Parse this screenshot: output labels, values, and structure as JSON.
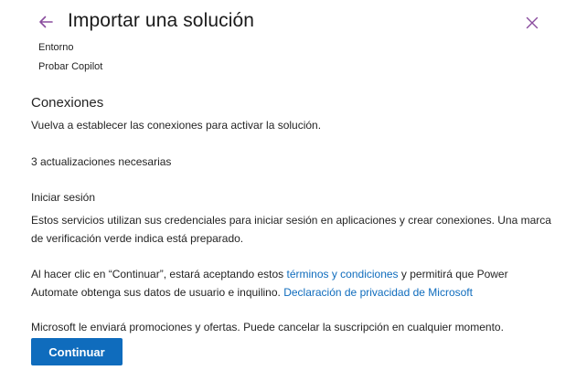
{
  "header": {
    "title": "Importar una solución",
    "back_icon": "arrow-left-icon",
    "close_icon": "close-icon",
    "accent_color": "#8a4d9e"
  },
  "environment": {
    "label": "Entorno",
    "value": "Probar Copilot"
  },
  "connections": {
    "title": "Conexiones",
    "description": "Vuelva a establecer las conexiones para activar la solución.",
    "updates_required": "3 actualizaciones necesarias"
  },
  "signin": {
    "title": "Iniciar sesión",
    "description": "Estos servicios utilizan sus credenciales para iniciar sesión en aplicaciones y crear conexiones. Una marca de verificación verde indica está preparado."
  },
  "terms": {
    "prefix": "Al hacer clic en “Continuar”, estará aceptando estos ",
    "terms_link": "términos y condiciones",
    "middle": " y permitirá que Power Automate obtenga sus datos de usuario e inquilino.  ",
    "privacy_link": "Declaración de privacidad de Microsoft"
  },
  "promo": {
    "text": "Microsoft le enviará promociones y ofertas. Puede cancelar la suscripción en cualquier momento."
  },
  "actions": {
    "continue_label": "Continuar",
    "primary_color": "#0f6cbd"
  }
}
